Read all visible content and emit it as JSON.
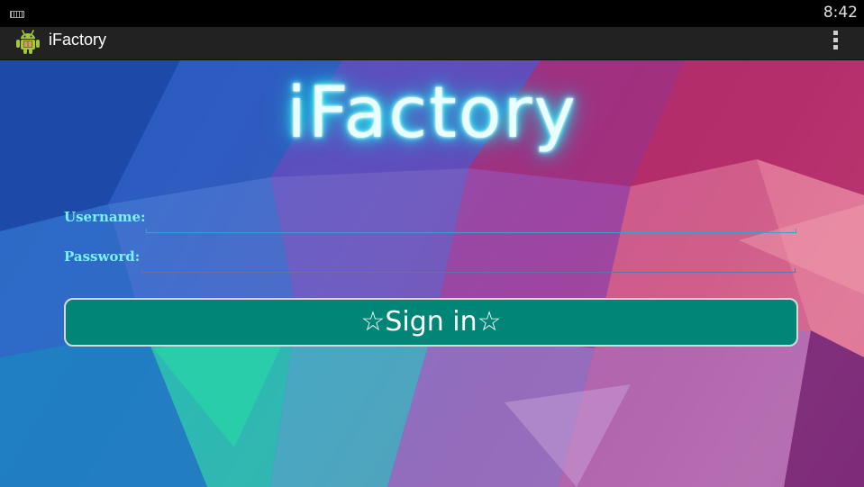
{
  "status_bar": {
    "time": "8:42",
    "left_icon": "keyboard-icon"
  },
  "action_bar": {
    "app_icon": "android-robot-icon",
    "title": "iFactory",
    "overflow_icon": "overflow-menu-icon"
  },
  "login": {
    "logo_text": "iFactory",
    "username_label": "Username:",
    "username_value": "",
    "password_label": "Password:",
    "password_value": "",
    "sign_in_label": "☆Sign in☆"
  },
  "colors": {
    "action_bar_bg": "#222222",
    "logo_glow": "#2ee6f0",
    "label": "#79f2f6",
    "button_bg": "#008576",
    "underline_username": "#3b9ed6",
    "underline_password": "#6a6fa8"
  }
}
